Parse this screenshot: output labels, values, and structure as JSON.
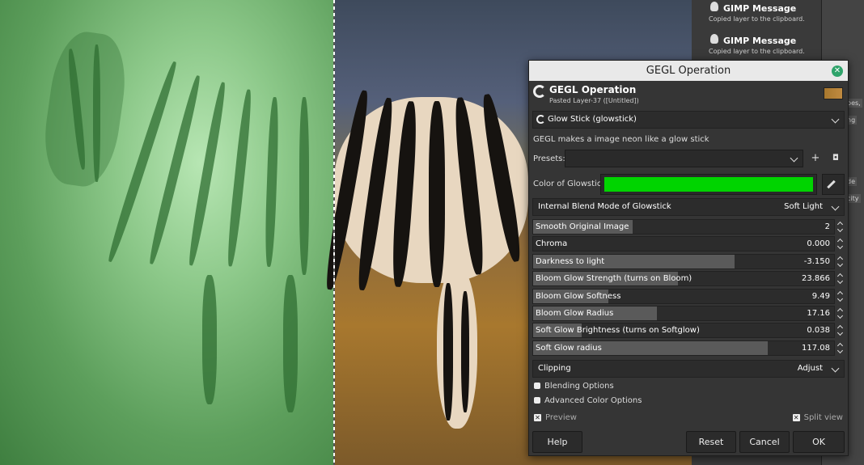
{
  "messages": [
    {
      "title": "GIMP Message",
      "text": "Copied layer to the clipboard."
    },
    {
      "title": "GIMP Message",
      "text": "Copied layer to the clipboard."
    }
  ],
  "dock_tags": [
    "pes,",
    "ng",
    "de",
    "city"
  ],
  "dialog": {
    "window_title": "GEGL Operation",
    "header_title": "GEGL Operation",
    "header_subtitle": "Pasted Layer-37 ([Untitled])",
    "operation": "Glow Stick (glowstick)",
    "description": "GEGL makes a image neon like a glow stick",
    "presets_label": "Presets:",
    "presets_value": "",
    "color_label": "Color of Glowstick",
    "color_value": "#00d400",
    "blend_label": "Internal Blend Mode of Glowstick",
    "blend_value": "Soft Light",
    "sliders": [
      {
        "name": "Smooth Original Image",
        "value": "2",
        "fill": 0.33
      },
      {
        "name": "Chroma",
        "value": "0.000",
        "fill": 0.0
      },
      {
        "name": "Darkness to light",
        "value": "-3.150",
        "fill": 0.67
      },
      {
        "name": "Bloom Glow Strength (turns on Bloom)",
        "value": "23.866",
        "fill": 0.48
      },
      {
        "name": "Bloom Glow Softness",
        "value": "9.49",
        "fill": 0.25
      },
      {
        "name": "Bloom Glow Radius",
        "value": "17.16",
        "fill": 0.41
      },
      {
        "name": "Soft Glow Brightness (turns on Softglow)",
        "value": "0.038",
        "fill": 0.16
      },
      {
        "name": "Soft Glow radius",
        "value": "117.08",
        "fill": 0.78
      }
    ],
    "clipping_label": "Clipping",
    "clipping_value": "Adjust",
    "blending_options": "Blending Options",
    "advanced_color_options": "Advanced Color Options",
    "preview_label": "Preview",
    "split_view_label": "Split view",
    "buttons": {
      "help": "Help",
      "reset": "Reset",
      "cancel": "Cancel",
      "ok": "OK"
    }
  }
}
